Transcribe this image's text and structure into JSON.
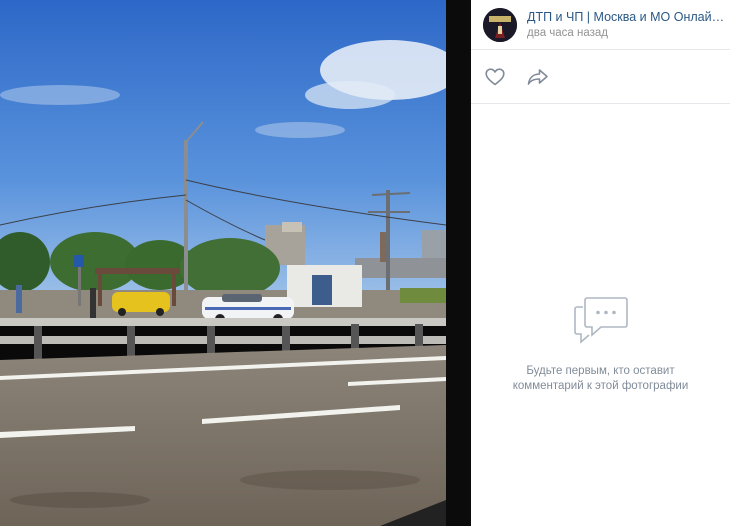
{
  "post": {
    "author": "ДТП и ЧП | Москва и МО Онлайн | …",
    "time": "два часа назад"
  },
  "actions": {
    "like_icon": "heart-icon",
    "share_icon": "share-arrow-icon"
  },
  "comments": {
    "empty_icon": "comments-bubble-icon",
    "empty_line1": "Будьте первым, кто оставит",
    "empty_line2": "комментарий к этой фотографии"
  },
  "colors": {
    "link": "#2a5885",
    "muted": "#939393",
    "icon": "#828a99",
    "empty_icon": "#aeb7c2"
  }
}
